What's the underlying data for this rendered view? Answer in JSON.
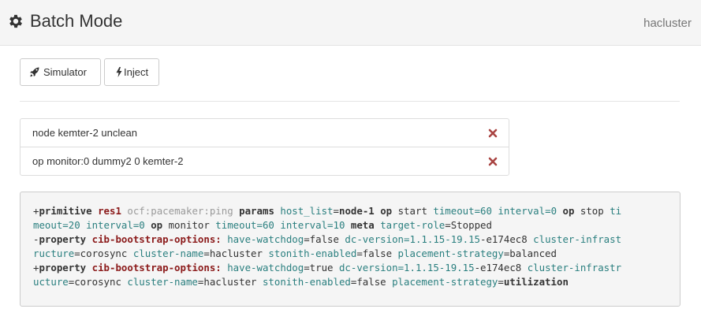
{
  "header": {
    "title": "Batch Mode",
    "cluster_name": "hacluster",
    "icon": "gear-icon"
  },
  "toolbar": {
    "simulator": {
      "label": "Simulator",
      "icon": "rocket-icon"
    },
    "inject": {
      "label": "Inject",
      "icon": "bolt-icon"
    }
  },
  "events": [
    {
      "text": "node kemter-2 unclean",
      "delete_icon": "remove-icon"
    },
    {
      "text": "op monitor:0 dummy2 0 kemter-2",
      "delete_icon": "remove-icon"
    }
  ],
  "diff": {
    "lines": [
      [
        {
          "t": "+",
          "c": "av"
        },
        {
          "t": "primitive",
          "c": "k"
        },
        {
          "t": " ",
          "c": "av"
        },
        {
          "t": "res1",
          "c": "id"
        },
        {
          "t": " ",
          "c": "av"
        },
        {
          "t": "ocf:pacemaker:ping",
          "c": "ra"
        },
        {
          "t": " ",
          "c": "av"
        },
        {
          "t": "params",
          "c": "k"
        },
        {
          "t": " ",
          "c": "av"
        },
        {
          "t": "host_list",
          "c": "an"
        },
        {
          "t": "=",
          "c": "av"
        },
        {
          "t": "node-1",
          "c": "avb"
        },
        {
          "t": " ",
          "c": "av"
        },
        {
          "t": "op",
          "c": "k"
        },
        {
          "t": " start ",
          "c": "av"
        },
        {
          "t": "timeout",
          "c": "an"
        },
        {
          "t": "=60 ",
          "c": "an"
        },
        {
          "t": "interval",
          "c": "an"
        },
        {
          "t": "=0",
          "c": "an"
        },
        {
          "t": " ",
          "c": "av"
        },
        {
          "t": "op",
          "c": "k"
        },
        {
          "t": " stop ",
          "c": "av"
        },
        {
          "t": "ti",
          "c": "an"
        }
      ],
      [
        {
          "t": "meout=20 ",
          "c": "an"
        },
        {
          "t": "interval=0",
          "c": "an"
        },
        {
          "t": " ",
          "c": "av"
        },
        {
          "t": "op",
          "c": "k"
        },
        {
          "t": " monitor ",
          "c": "av"
        },
        {
          "t": "timeout=60",
          "c": "an"
        },
        {
          "t": " ",
          "c": "av"
        },
        {
          "t": "interval=10",
          "c": "an"
        },
        {
          "t": " ",
          "c": "av"
        },
        {
          "t": "meta",
          "c": "k"
        },
        {
          "t": " ",
          "c": "av"
        },
        {
          "t": "target-role",
          "c": "an"
        },
        {
          "t": "=Stopped",
          "c": "av"
        }
      ],
      [
        {
          "t": "-",
          "c": "av"
        },
        {
          "t": "property",
          "c": "k"
        },
        {
          "t": " ",
          "c": "av"
        },
        {
          "t": "cib-bootstrap-options:",
          "c": "id"
        },
        {
          "t": " ",
          "c": "av"
        },
        {
          "t": "have-watchdog",
          "c": "an"
        },
        {
          "t": "=false ",
          "c": "av"
        },
        {
          "t": "dc-version",
          "c": "an"
        },
        {
          "t": "=1.1.15-19.15",
          "c": "an"
        },
        {
          "t": "-e174ec8 ",
          "c": "av"
        },
        {
          "t": "cluster-infrast",
          "c": "an"
        }
      ],
      [
        {
          "t": "ructure",
          "c": "an"
        },
        {
          "t": "=corosync ",
          "c": "av"
        },
        {
          "t": "cluster-name",
          "c": "an"
        },
        {
          "t": "=hacluster ",
          "c": "av"
        },
        {
          "t": "stonith-enabled",
          "c": "an"
        },
        {
          "t": "=false ",
          "c": "av"
        },
        {
          "t": "placement-strategy",
          "c": "an"
        },
        {
          "t": "=balanced",
          "c": "av"
        }
      ],
      [
        {
          "t": "+",
          "c": "av"
        },
        {
          "t": "property",
          "c": "k"
        },
        {
          "t": " ",
          "c": "av"
        },
        {
          "t": "cib-bootstrap-options:",
          "c": "id"
        },
        {
          "t": " ",
          "c": "av"
        },
        {
          "t": "have-watchdog",
          "c": "an"
        },
        {
          "t": "=true ",
          "c": "av"
        },
        {
          "t": "dc-version",
          "c": "an"
        },
        {
          "t": "=1.1.15-19.15",
          "c": "an"
        },
        {
          "t": "-e174ec8 ",
          "c": "av"
        },
        {
          "t": "cluster-infrastr",
          "c": "an"
        }
      ],
      [
        {
          "t": "ucture",
          "c": "an"
        },
        {
          "t": "=corosync ",
          "c": "av"
        },
        {
          "t": "cluster-name",
          "c": "an"
        },
        {
          "t": "=hacluster ",
          "c": "av"
        },
        {
          "t": "stonith-enabled",
          "c": "an"
        },
        {
          "t": "=false ",
          "c": "av"
        },
        {
          "t": "placement-strategy",
          "c": "an"
        },
        {
          "t": "=",
          "c": "av"
        },
        {
          "t": "utilization",
          "c": "avb"
        }
      ]
    ]
  }
}
